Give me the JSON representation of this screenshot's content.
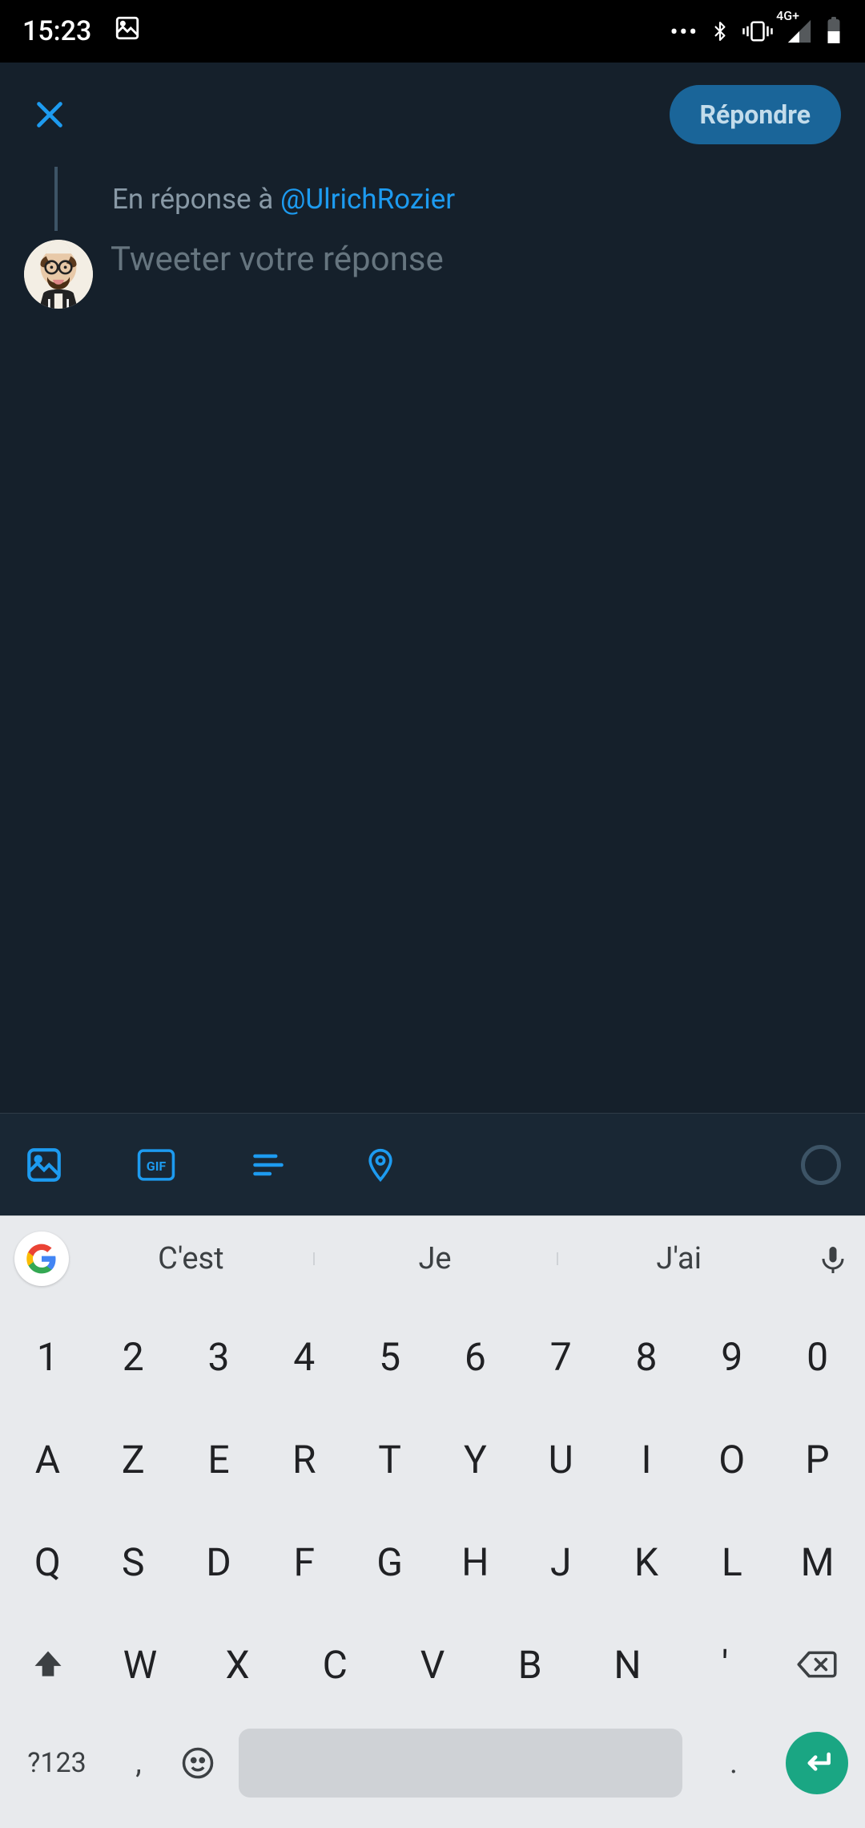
{
  "status": {
    "time": "15:23",
    "net": "4G+"
  },
  "header": {
    "reply_label": "Répondre"
  },
  "compose": {
    "reply_to_prefix": "En réponse à ",
    "reply_to_handle": "@UlrichRozier",
    "placeholder": "Tweeter votre réponse"
  },
  "toolbar": {
    "icons": [
      "image-icon",
      "gif-icon",
      "poll-icon",
      "location-icon"
    ]
  },
  "keyboard": {
    "suggestions": [
      "C'est",
      "Je",
      "J'ai"
    ],
    "row_num": [
      "1",
      "2",
      "3",
      "4",
      "5",
      "6",
      "7",
      "8",
      "9",
      "0"
    ],
    "row1": [
      "A",
      "Z",
      "E",
      "R",
      "T",
      "Y",
      "U",
      "I",
      "O",
      "P"
    ],
    "row2": [
      "Q",
      "S",
      "D",
      "F",
      "G",
      "H",
      "J",
      "K",
      "L",
      "M"
    ],
    "row3": [
      "W",
      "X",
      "C",
      "V",
      "B",
      "N",
      "'"
    ],
    "sym_label": "?123",
    "comma": ",",
    "dot": "."
  }
}
